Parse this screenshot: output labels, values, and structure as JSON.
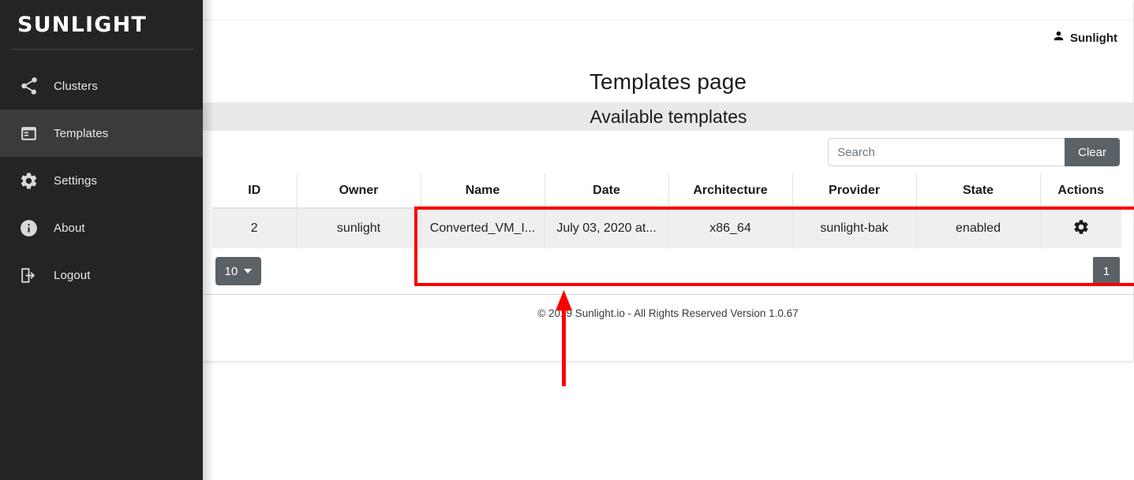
{
  "sidebar": {
    "logo_text": "SUNLIGHT",
    "items": [
      {
        "label": "Clusters",
        "icon": "share-icon",
        "active": false
      },
      {
        "label": "Templates",
        "icon": "web-asset-icon",
        "active": true
      },
      {
        "label": "Settings",
        "icon": "gear-icon",
        "active": false
      },
      {
        "label": "About",
        "icon": "info-icon",
        "active": false
      },
      {
        "label": "Logout",
        "icon": "logout-icon",
        "active": false
      }
    ]
  },
  "header": {
    "user_name": "Sunlight",
    "user_icon": "person-icon"
  },
  "main": {
    "page_title": "Templates page",
    "section_title": "Available templates"
  },
  "search": {
    "placeholder": "Search",
    "value": "",
    "clear_label": "Clear"
  },
  "table": {
    "columns": [
      "ID",
      "Owner",
      "Name",
      "Date",
      "Architecture",
      "Provider",
      "State",
      "Actions"
    ],
    "rows": [
      {
        "id": "2",
        "owner": "sunlight",
        "name": "Converted_VM_I...",
        "date": "July 03, 2020 at...",
        "architecture": "x86_64",
        "provider": "sunlight-bak",
        "state": "enabled",
        "actions_icon": "gear-icon"
      }
    ]
  },
  "pagination": {
    "per_page": "10",
    "current_page": "1"
  },
  "footer": {
    "text": "© 2019 Sunlight.io - All Rights Reserved Version 1.0.67"
  },
  "annotation": {
    "highlight_color": "#fa0000",
    "arrow_color": "#fa0000"
  }
}
